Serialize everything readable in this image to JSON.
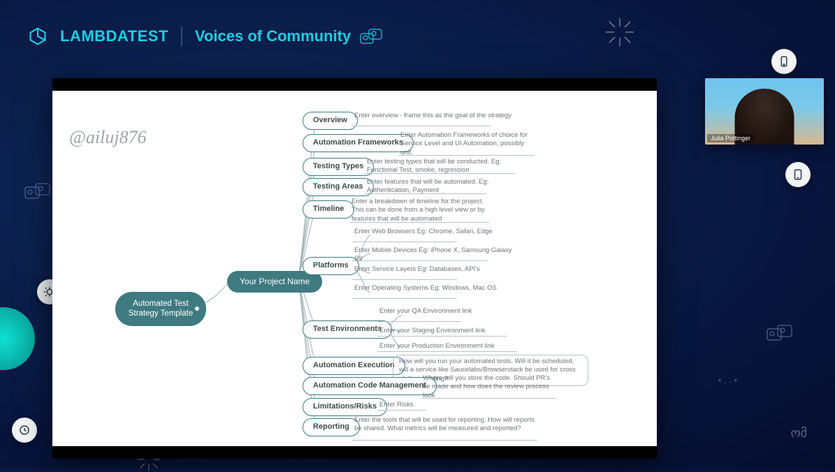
{
  "brand": {
    "name": "LAMBDATEST"
  },
  "header": {
    "tagline": "Voices of Community"
  },
  "presenter": {
    "name": "Julia Pottinger",
    "handle": "@ailuj876"
  },
  "mindmap": {
    "root": "Automated Test Strategy Template",
    "project": "Your Project Name",
    "topics": [
      {
        "key": "overview",
        "label": "Overview",
        "note": "Enter overview - frame this as the goal of the strategy"
      },
      {
        "key": "frameworks",
        "label": "Automation Frameworks",
        "note": "Enter Automation Frameworks of choice for Service Level and UI Automation, possibly unit."
      },
      {
        "key": "types",
        "label": "Testing Types",
        "note": "Enter testing types that will be conducted. Eg: Functional Test, smoke, regression"
      },
      {
        "key": "areas",
        "label": "Testing Areas",
        "note": "Enter features that will be automated. Eg: Authentication, Payment"
      },
      {
        "key": "timeline",
        "label": "Timeline",
        "note": "Enter a breakdown of timeline for the project. This can be done from a high level view or by features that will be automated"
      },
      {
        "key": "platforms",
        "label": "Platforms",
        "children": [
          {
            "note": "Enter Web Browsers Eg: Chrome, Safari, Edge"
          },
          {
            "note": "Enter Mobile Devices Eg: iPhone X, Samsung Galaxy S9"
          },
          {
            "note": "Enter Service Layers Eg: Databases, API's"
          },
          {
            "note": "Enter Operating Systems Eg: Windows, Mac OS"
          }
        ]
      },
      {
        "key": "envs",
        "label": "Test Environments",
        "children": [
          {
            "note": "Enter your QA Environment link"
          },
          {
            "note": "Enter your Staging Environment link"
          },
          {
            "note": "Enter your Production Environment link"
          }
        ]
      },
      {
        "key": "exec",
        "label": "Automation Execution",
        "note": "How will you run your automated tests. Will it be scheduled, will a service like Saucelabs/Browserstack be used for cross platform testing?"
      },
      {
        "key": "code",
        "label": "Automation Code Management",
        "note": "Where will you store the code. Should PR's be made and how does the review process look"
      },
      {
        "key": "risks",
        "label": "Limitations/Risks",
        "note": "Enter Risks"
      },
      {
        "key": "report",
        "label": "Reporting",
        "note": "Enter the tools that will be used for reporting. How will reports be shared. What metrics will be measured and reported?"
      }
    ]
  }
}
